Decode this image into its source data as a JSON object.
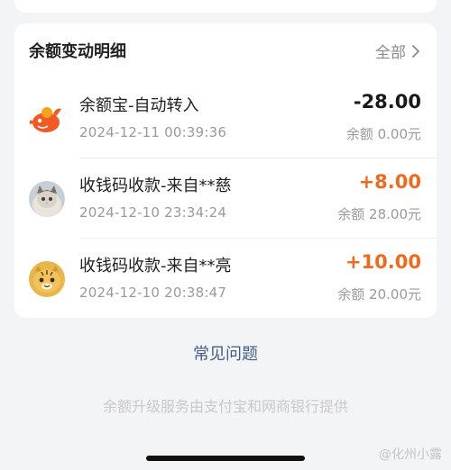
{
  "card": {
    "title": "余额变动明细",
    "filter_label": "全部"
  },
  "transactions": [
    {
      "name": "余额宝-自动转入",
      "time": "2024-12-11 00:39:36",
      "amount": "-28.00",
      "amount_color": "#1a1a1a",
      "balance": "余额 0.00元",
      "icon": "yuebao-fish-icon"
    },
    {
      "name": "收钱码收款-来自**慈",
      "time": "2024-12-10 23:34:24",
      "amount": "+8.00",
      "amount_color": "#f06a1e",
      "balance": "余额 28.00元",
      "icon": "cat-avatar"
    },
    {
      "name": "收钱码收款-来自**亮",
      "time": "2024-12-10 20:38:47",
      "amount": "+10.00",
      "amount_color": "#f06a1e",
      "balance": "余额 20.00元",
      "icon": "tiger-avatar"
    }
  ],
  "faq_label": "常见问题",
  "footer_note": "余额升级服务由支付宝和网商银行提供",
  "watermark": "@化州小露"
}
